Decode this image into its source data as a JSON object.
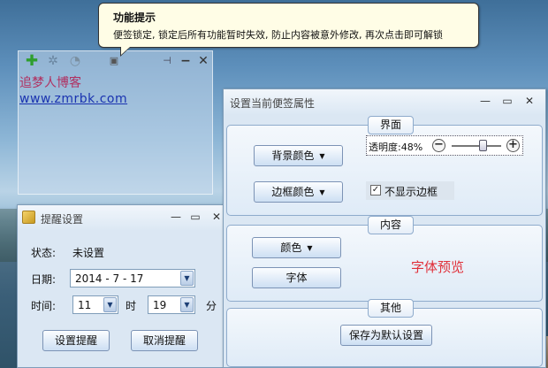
{
  "tooltip": {
    "title": "功能提示",
    "body": "便签锁定, 锁定后所有功能暂时失效, 防止内容被意外修改, 再次点击即可解锁"
  },
  "note": {
    "line1": "追梦人博客",
    "line2": "www.zmrbk.com",
    "icons": [
      "add-icon",
      "settings-icon",
      "clock-icon",
      "lock-icon",
      "pin-icon",
      "minimize-icon",
      "close-icon"
    ]
  },
  "reminder": {
    "title": "提醒设置",
    "status_label": "状态:",
    "status_value": "未设置",
    "date_label": "日期:",
    "date_value": "2014 - 7 - 17",
    "time_label": "时间:",
    "hour_value": "11",
    "hour_unit": "时",
    "minute_value": "19",
    "minute_unit": "分",
    "set_button": "设置提醒",
    "cancel_button": "取消提醒"
  },
  "properties": {
    "title": "设置当前便签属性",
    "group_appearance": "界面",
    "bg_color_button": "背景颜色",
    "border_color_button": "边框颜色",
    "opacity_label": "透明度:48%",
    "opacity_value": 0.48,
    "hide_border_label": "不显示边框",
    "hide_border_checked": true,
    "group_content": "内容",
    "color_button": "颜色",
    "font_button": "字体",
    "font_preview": "字体预览",
    "group_other": "其他",
    "save_default_button": "保存为默认设置"
  },
  "colors": {
    "note_line1": "#b03060",
    "note_line2": "#1a33b0",
    "preview_text": "#e0303a"
  }
}
